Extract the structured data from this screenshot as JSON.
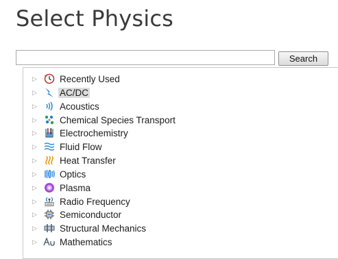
{
  "header": {
    "title": "Select Physics"
  },
  "search": {
    "value": "",
    "placeholder": "",
    "button_label": "Search"
  },
  "tree": {
    "items": [
      {
        "label": "Recently Used",
        "icon": "clock-icon"
      },
      {
        "label": "AC/DC",
        "icon": "lightning-icon",
        "selected": true
      },
      {
        "label": "Acoustics",
        "icon": "sound-waves-icon"
      },
      {
        "label": "Chemical Species Transport",
        "icon": "molecules-icon"
      },
      {
        "label": "Electrochemistry",
        "icon": "beaker-icon"
      },
      {
        "label": "Fluid Flow",
        "icon": "flow-waves-icon"
      },
      {
        "label": "Heat Transfer",
        "icon": "heat-icon"
      },
      {
        "label": "Optics",
        "icon": "optics-icon"
      },
      {
        "label": "Plasma",
        "icon": "plasma-icon"
      },
      {
        "label": "Radio Frequency",
        "icon": "antenna-icon"
      },
      {
        "label": "Semiconductor",
        "icon": "chip-icon"
      },
      {
        "label": "Structural Mechanics",
        "icon": "beam-icon"
      },
      {
        "label": "Mathematics",
        "icon": "math-icon"
      }
    ]
  },
  "colors": {
    "selection": "#dcdcdc",
    "lightning": "#1e7fd6",
    "heat": "#f0a020",
    "plasma": "#a24ed6"
  }
}
